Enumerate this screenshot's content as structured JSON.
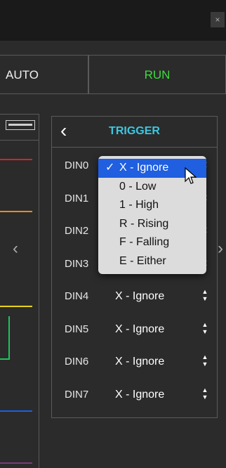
{
  "window": {
    "close_label": "×"
  },
  "mode": {
    "auto_label": "AUTO",
    "run_label": "RUN",
    "run_color": "#3ddc3d"
  },
  "channel_colors": [
    "#e02020",
    "#f08a1c",
    "#e8d218",
    "#1fc45a",
    "#1d5fe0",
    "#7a3b7a"
  ],
  "trigger": {
    "title": "TRIGGER",
    "back_icon": "chevron-left-icon",
    "rows": [
      {
        "label": "DIN0",
        "value": ""
      },
      {
        "label": "DIN1",
        "value": ""
      },
      {
        "label": "DIN2",
        "value": ""
      },
      {
        "label": "DIN3",
        "value": ""
      },
      {
        "label": "DIN4",
        "value": "X - Ignore"
      },
      {
        "label": "DIN5",
        "value": "X - Ignore"
      },
      {
        "label": "DIN6",
        "value": "X - Ignore"
      },
      {
        "label": "DIN7",
        "value": "X - Ignore"
      }
    ]
  },
  "dropdown": {
    "check": "✓",
    "options": [
      "X - Ignore",
      "0 - Low",
      "1 - High",
      "R - Rising",
      "F - Falling",
      "E - Either"
    ],
    "selected": "X - Ignore"
  },
  "nav": {
    "left_icon": "chevron-left-icon",
    "right_icon": "chevron-right-icon"
  }
}
